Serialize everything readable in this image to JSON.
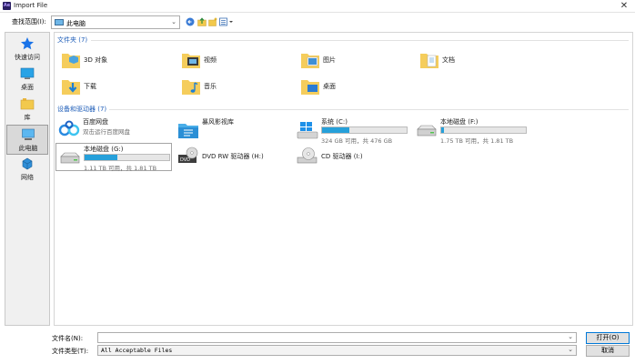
{
  "window": {
    "title": "Import File",
    "app_icon_text": "Ae"
  },
  "toolbar": {
    "look_in_label": "查找范围(I):",
    "look_in_value": "此电脑"
  },
  "sidebar": {
    "items": [
      {
        "label": "快速访问",
        "icon": "star-icon"
      },
      {
        "label": "桌面",
        "icon": "desktop-icon"
      },
      {
        "label": "库",
        "icon": "library-icon"
      },
      {
        "label": "此电脑",
        "icon": "computer-icon"
      },
      {
        "label": "网络",
        "icon": "network-icon"
      }
    ]
  },
  "folders": {
    "header": "文件夹 (7)",
    "items": [
      {
        "label": "3D 对象",
        "icon": "3d-objects-folder-icon"
      },
      {
        "label": "视频",
        "icon": "videos-folder-icon"
      },
      {
        "label": "图片",
        "icon": "pictures-folder-icon"
      },
      {
        "label": "文档",
        "icon": "documents-folder-icon"
      },
      {
        "label": "下载",
        "icon": "downloads-folder-icon"
      },
      {
        "label": "音乐",
        "icon": "music-folder-icon"
      },
      {
        "label": "桌面",
        "icon": "desktop-folder-icon"
      }
    ]
  },
  "devices": {
    "header": "设备和驱动器 (7)",
    "items": [
      {
        "name": "百度网盘",
        "sub": "双击运行百度网盘",
        "icon": "baidu-netdisk-icon"
      },
      {
        "name": "暴风影视库",
        "icon": "storm-library-icon"
      },
      {
        "name": "系统 (C:)",
        "size": "324 GB 可用，共 476 GB",
        "used": 0.32,
        "icon": "windows-drive-icon"
      },
      {
        "name": "本地磁盘 (F:)",
        "size": "1.75 TB 可用，共 1.81 TB",
        "used": 0.03,
        "icon": "hard-drive-icon"
      },
      {
        "name": "本地磁盘 (G:)",
        "size": "1.11 TB 可用，共 1.81 TB",
        "used": 0.39,
        "icon": "hard-drive-icon"
      },
      {
        "name": "DVD RW 驱动器 (H:)",
        "icon": "dvd-drive-icon"
      },
      {
        "name": "CD 驱动器 (I:)",
        "icon": "cd-drive-icon"
      }
    ]
  },
  "bottom": {
    "filename_label": "文件名(N):",
    "filename_value": "",
    "filetype_label": "文件类型(T):",
    "filetype_value": "All Acceptable Files",
    "open_button": "打开(O)",
    "cancel_button": "取消"
  },
  "colors": {
    "accent": "#1e5db8",
    "progress": "#26a0da"
  }
}
